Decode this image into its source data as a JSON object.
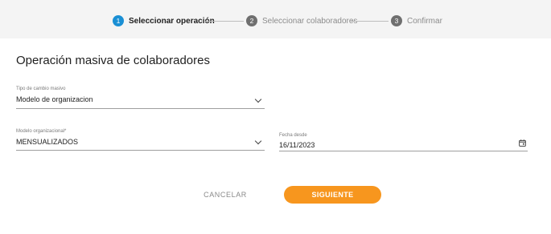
{
  "stepper": {
    "steps": [
      {
        "number": "1",
        "label": "Seleccionar operación",
        "state": "active"
      },
      {
        "number": "2",
        "label": "Seleccionar colaboradores",
        "state": "inactive"
      },
      {
        "number": "3",
        "label": "Confirmar",
        "state": "inactive"
      }
    ]
  },
  "page": {
    "title": "Operación masiva de colaboradores"
  },
  "form": {
    "tipo_cambio": {
      "label": "Tipo de cambio masivo",
      "value": "Modelo de organizacion"
    },
    "modelo_organizacional": {
      "label": "Modelo organizacional*",
      "value": "MENSUALIZADOS"
    },
    "fecha_desde": {
      "label": "Fecha desde",
      "value": "16/11/2023"
    }
  },
  "actions": {
    "cancel_label": "CANCELAR",
    "next_label": "SIGUIENTE"
  },
  "colors": {
    "active_step": "#1a8fd4",
    "inactive_step": "#6f6f6f",
    "primary_button": "#f7961e",
    "stepper_background": "#f4f4f4"
  }
}
